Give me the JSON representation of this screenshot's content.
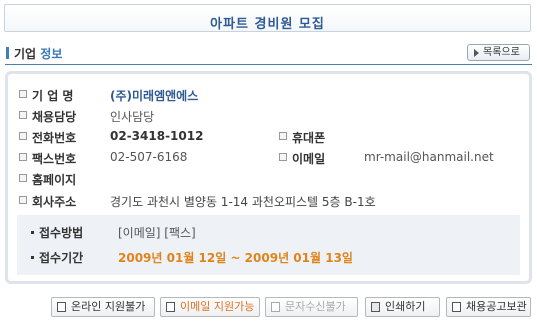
{
  "page_title": "아파트 경비원 모집",
  "section": {
    "title_part1": "기업",
    "title_part2": "정보",
    "back_button": "목록으로"
  },
  "company": {
    "name_label": "기 업 명",
    "name": "(주)미래엠앤에스",
    "recruiter_label": "채용담당",
    "recruiter": "인사담당",
    "phone_label": "전화번호",
    "phone": "02-3418-1012",
    "mobile_label": "휴대폰",
    "mobile": "",
    "fax_label": "팩스번호",
    "fax": "02-507-6168",
    "email_label": "이메일",
    "email": "mr-mail@hanmail.net",
    "homepage_label": "홈페이지",
    "homepage": "",
    "address_label": "회사주소",
    "address": "경기도 과천시 별양동 1-14 과천오피스텔 5층 B-1호"
  },
  "application": {
    "method_label": "접수방법",
    "method": "[이메일] [팩스]",
    "period_label": "접수기간",
    "period": "2009년 01월 12일 ~ 2009년 01월 13일"
  },
  "buttons": {
    "online_apply": "온라인 지원불가",
    "email_apply": "이메일 지원가능",
    "sms_receive": "문자수신불가",
    "print": "인쇄하기",
    "save": "채용공고보관"
  },
  "colors": {
    "title_blue": "#2f5a93",
    "accent_orange": "#e0841a",
    "email_btn_orange": "#e07020"
  }
}
